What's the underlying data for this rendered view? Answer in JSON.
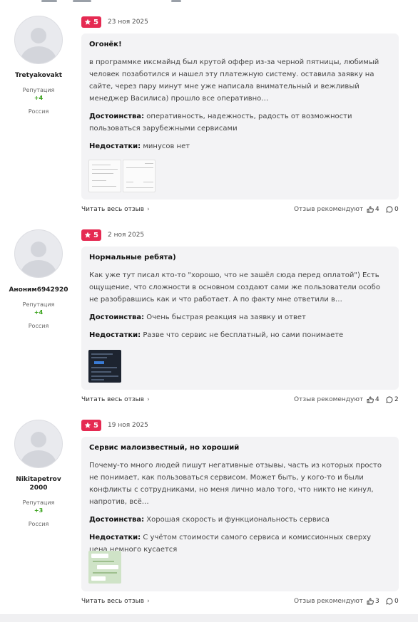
{
  "labels": {
    "reputation": "Репутация",
    "read_full": "Читать весь отзыв",
    "recommended": "Отзыв рекомендуют",
    "pros": "Достоинства:",
    "cons": "Недостатки:"
  },
  "reviews": [
    {
      "username": "Tretyakovakt",
      "reputation": "+4",
      "country": "Россия",
      "rating": "5",
      "date": "23 ноя 2025",
      "title": "Огонёк!",
      "text": "в программке иксмайнд был крутой оффер из-за черной пятницы, любимый человек позаботился и нашел эту платежную систему. оставила заявку на сайте, через пару минут мне уже написала внимательный и вежливый менеджер Василиса) прошло все оперативно…",
      "pros": "оперативность, надежность, радость от возможности пользоваться зарубежными сервисами",
      "cons": "минусов нет",
      "likes": "4",
      "comments": "0"
    },
    {
      "username": "Аноним6942920",
      "reputation": "+4",
      "country": "Россия",
      "rating": "5",
      "date": "2 ноя 2025",
      "title": "Нормальные ребята)",
      "text": "Как уже тут писал кто-то \"хорошо, что не зашёл сюда перед оплатой\") Есть ощущение, что сложности в основном создают сами же пользователи особо не разобравшись как и что работает. А по факту мне ответили в…",
      "pros": "Очень быстрая реакция на заявку и ответ",
      "cons": "Разве что сервис не бесплатный, но сами понимаете",
      "likes": "4",
      "comments": "2"
    },
    {
      "username": "Nikitapetrov 2000",
      "reputation": "+3",
      "country": "Россия",
      "rating": "5",
      "date": "19 ноя 2025",
      "title": "Сервис малоизвестный, но хороший",
      "text": "Почему-то много людей пишут негативные отзывы, часть из которых просто не понимает, как пользоваться сервисом. Может быть, у кого-то и были конфликты с сотрудниками, но меня лично мало того, что никто не кинул, напротив, всё…",
      "pros": "Хорошая скорость и функциональность сервиса",
      "cons": "С учётом стоимости самого сервиса и комиссионных сверху цена немного кусается",
      "likes": "3",
      "comments": "0"
    }
  ]
}
